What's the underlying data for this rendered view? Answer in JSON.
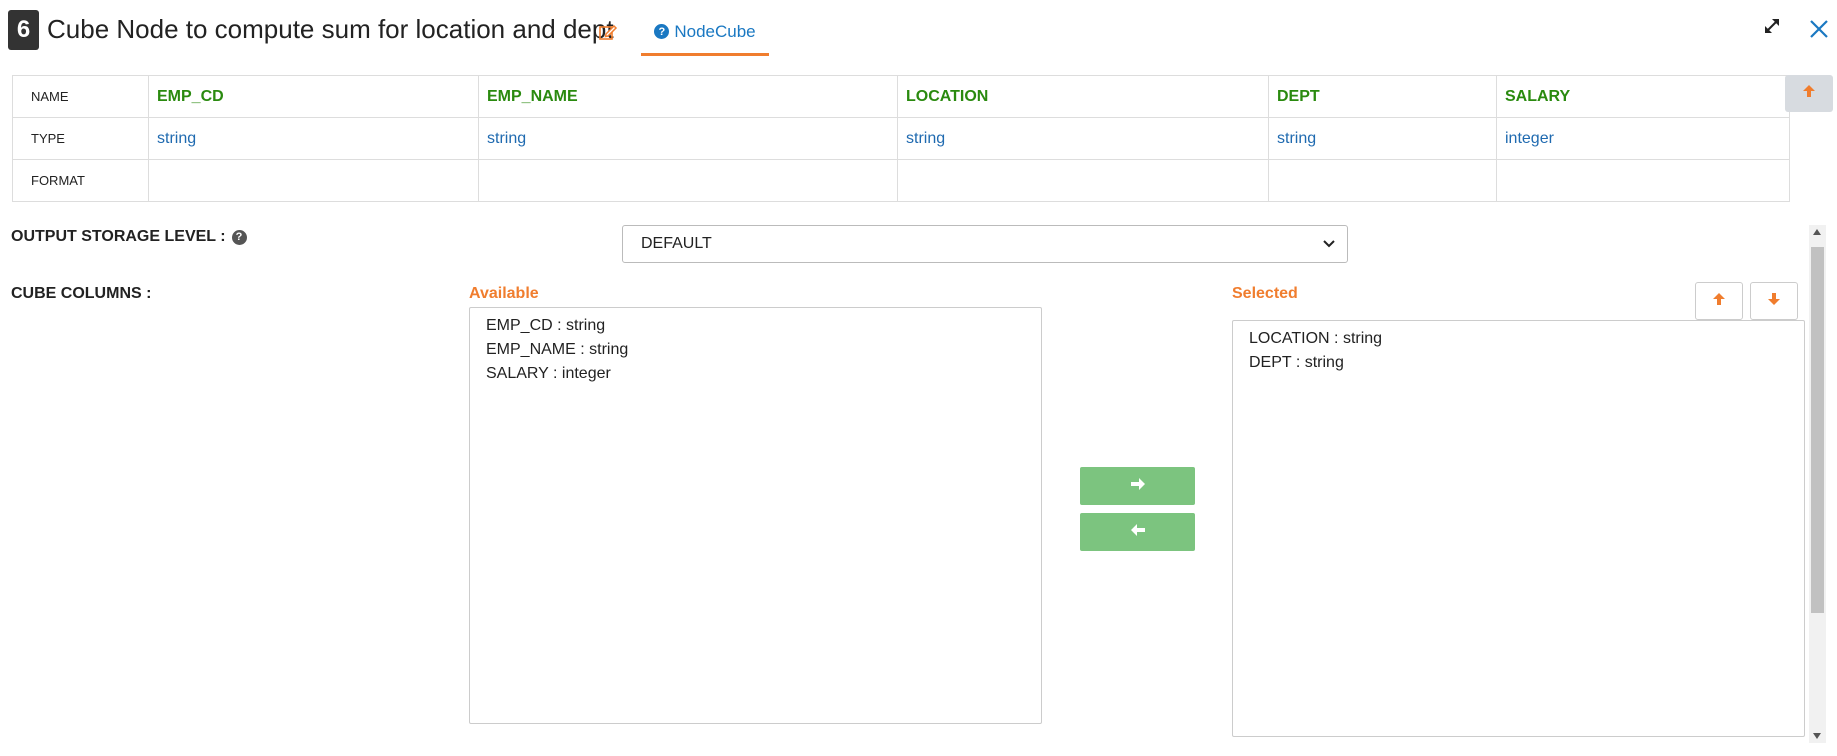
{
  "header": {
    "node_number": "6",
    "title": "Cube Node to compute sum for location and dept",
    "help_tab_label": "NodeCube"
  },
  "schema": {
    "row_labels": [
      "NAME",
      "TYPE",
      "FORMAT"
    ],
    "columns": [
      {
        "name": "EMP_CD",
        "type": "string",
        "format": ""
      },
      {
        "name": "EMP_NAME",
        "type": "string",
        "format": ""
      },
      {
        "name": "LOCATION",
        "type": "string",
        "format": ""
      },
      {
        "name": "DEPT",
        "type": "string",
        "format": ""
      },
      {
        "name": "SALARY",
        "type": "integer",
        "format": ""
      }
    ]
  },
  "form": {
    "storage_label": "OUTPUT STORAGE LEVEL :",
    "storage_value": "DEFAULT",
    "cube_columns_label": "CUBE COLUMNS :",
    "available_label": "Available",
    "selected_label": "Selected",
    "available_items": [
      "EMP_CD : string",
      "EMP_NAME : string",
      "SALARY : integer"
    ],
    "selected_items": [
      "LOCATION : string",
      "DEPT : string"
    ]
  },
  "colors": {
    "accent_orange": "#f07d2e",
    "name_green": "#2a8a0f",
    "type_blue": "#1f6ab0",
    "button_green": "#7cc47f"
  }
}
